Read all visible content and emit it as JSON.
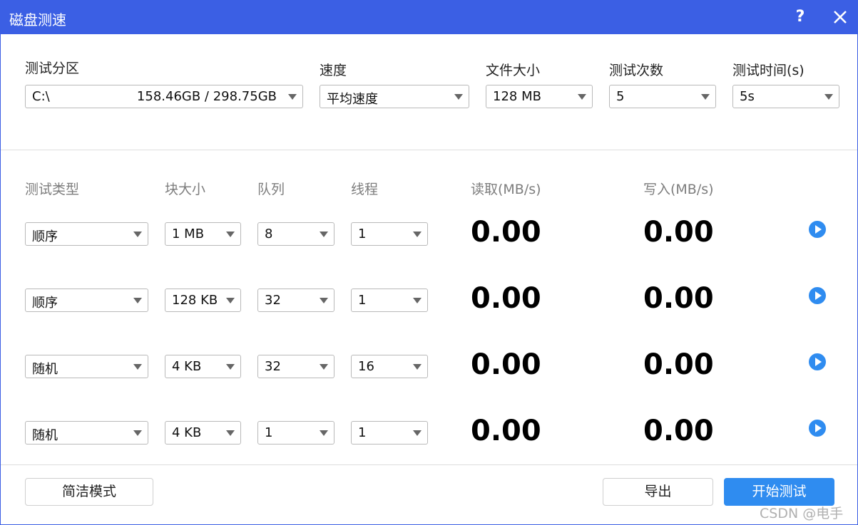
{
  "window": {
    "title": "磁盘测速"
  },
  "titlebar": {
    "help": "?"
  },
  "settings": {
    "partition": {
      "label": "测试分区",
      "drive": "C:\\",
      "usage": "158.46GB / 298.75GB"
    },
    "speed": {
      "label": "速度",
      "value": "平均速度"
    },
    "file_size": {
      "label": "文件大小",
      "value": "128 MB"
    },
    "test_count": {
      "label": "测试次数",
      "value": "5"
    },
    "test_time": {
      "label": "测试时间(s)",
      "value": "5s"
    }
  },
  "table": {
    "headers": [
      "测试类型",
      "块大小",
      "队列",
      "线程",
      "读取(MB/s)",
      "写入(MB/s)"
    ],
    "rows": [
      {
        "type": "顺序",
        "block": "1 MB",
        "queue": "8",
        "threads": "1",
        "read": "0.00",
        "write": "0.00"
      },
      {
        "type": "顺序",
        "block": "128 KB",
        "queue": "32",
        "threads": "1",
        "read": "0.00",
        "write": "0.00"
      },
      {
        "type": "随机",
        "block": "4 KB",
        "queue": "32",
        "threads": "16",
        "read": "0.00",
        "write": "0.00"
      },
      {
        "type": "随机",
        "block": "4 KB",
        "queue": "1",
        "threads": "1",
        "read": "0.00",
        "write": "0.00"
      }
    ]
  },
  "footer": {
    "simple_mode": "简洁模式",
    "export": "导出",
    "start": "开始测试"
  },
  "watermark": "CSDN @电手",
  "colors": {
    "titlebar": "#3b5fe4",
    "accent": "#2f8cf0"
  }
}
